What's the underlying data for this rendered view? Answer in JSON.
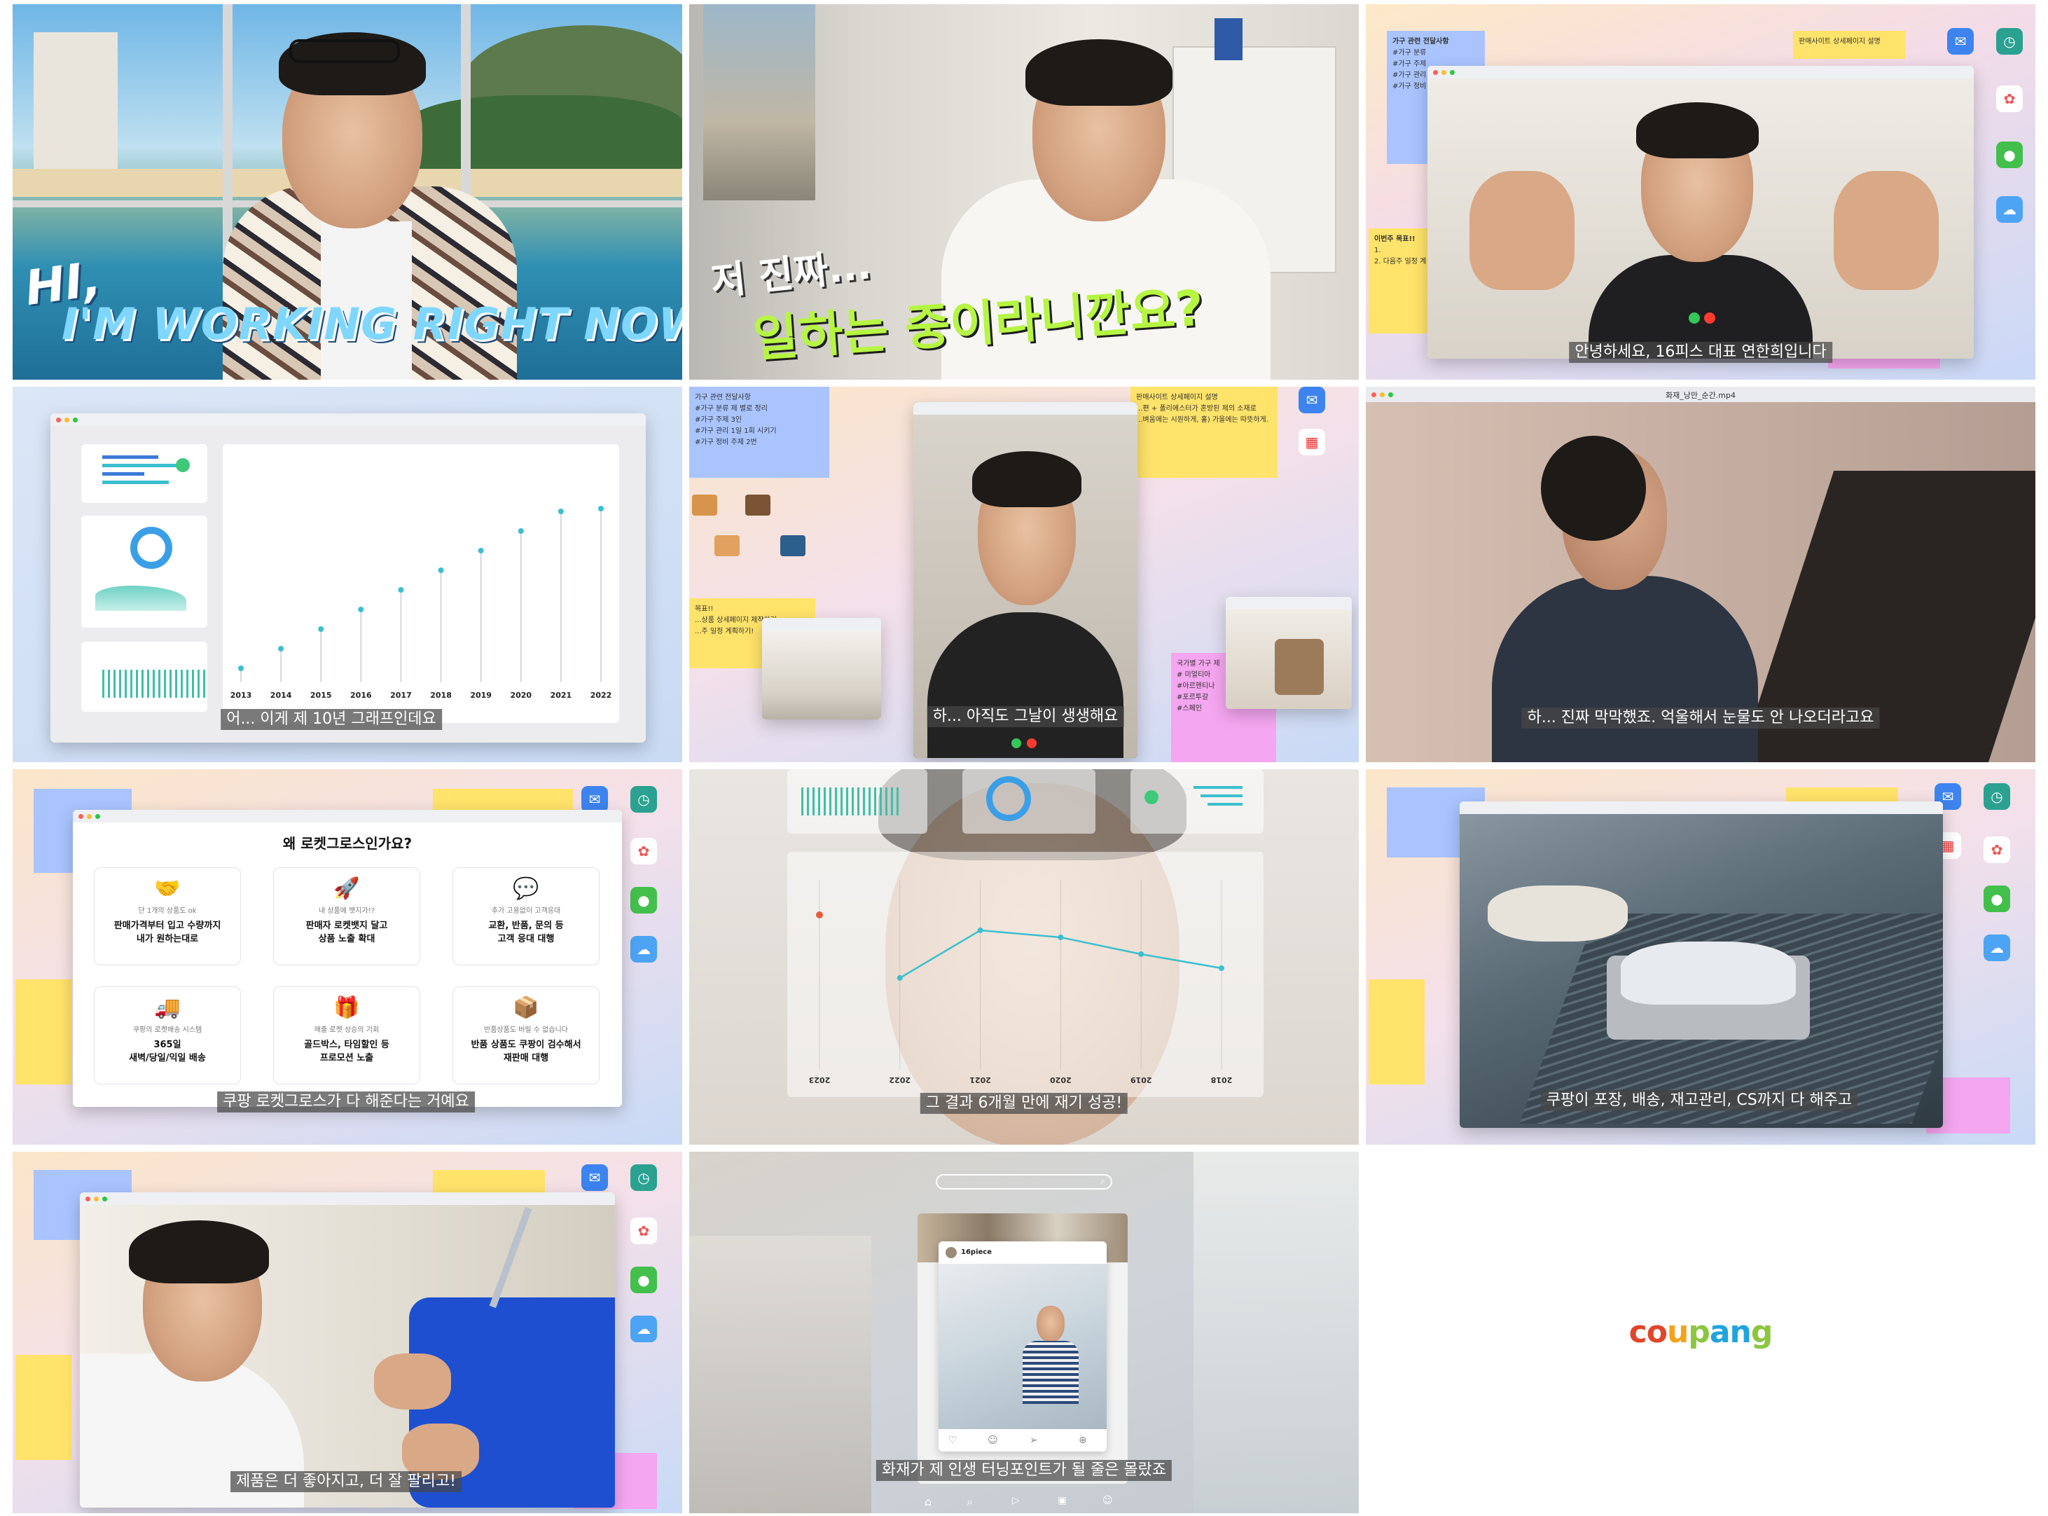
{
  "tiles": {
    "t1": {
      "title_line1": "HI,",
      "title_line2": "I'M WORKING RIGHT NOW"
    },
    "t2": {
      "line1": "저 진짜...",
      "line2": "일하는 중이라니깐요?"
    },
    "t3": {
      "caption": "안녕하세요, 16피스 대표 연한희입니다",
      "sticky_blue_title": "가구 관련 전달사항",
      "sticky_blue_items": [
        "#가구 분류 ",
        "#가구 주제 ",
        "#가구 관리 ",
        "#가구 정비 "
      ],
      "sticky_yellow_title": "판매사이트 상세페이지 설명",
      "sticky_left_title": "이번주 목표!!",
      "sticky_left_items": [
        "1.",
        "2. 다음주 일정 계"
      ]
    },
    "t4": {
      "caption": "어... 이게 제 10년 그래프인데요",
      "years": [
        "2013",
        "2014",
        "2015",
        "2016",
        "2017",
        "2018",
        "2019",
        "2020",
        "2021",
        "2022"
      ]
    },
    "t5": {
      "caption": "하... 아직도 그날이 생생해요",
      "sticky_blue_items": [
        "가구 관련 전달사항",
        "#가구 분류 제 별로 정리",
        "#가구 주제 3인",
        "#가구 관리 1일 1회 시키기",
        "#가구 정비 주제 2번"
      ],
      "sticky_yellow_items": [
        "판매사이트 상세페이지 설명",
        "...편 + 폴리에스터가 혼방된 제의 소재로",
        "...벼움에는 시원하게, 홀) 가을에는 따뜻하게."
      ],
      "sticky_yellow2_items": [
        "목표!!",
        "...상품 상세페이지 제작하기.",
        "...주 일정 계획하기!"
      ],
      "sticky_pink_items": [
        "국가별 가구 제",
        "# 미얼티아",
        "#아르헨티나",
        "#포르투갈",
        "#스페인"
      ]
    },
    "t6": {
      "caption": "하... 진짜 막막했죠. 억울해서 눈물도 안 나오더라고요",
      "filename": "화재_낭만_순간.mp4"
    },
    "t7": {
      "caption": "쿠팡 로켓그로스가 다 해준다는 거예요",
      "heading": "왜 로켓그로스인가요?",
      "features": [
        {
          "icon": "handshake-icon",
          "glyph": "🤝",
          "sub": "단 1개의 상품도 ok",
          "main": [
            "판매가격부터 입고 수량까지",
            "내가 원하는대로"
          ]
        },
        {
          "icon": "rocket-icon",
          "glyph": "🚀",
          "sub": "내 상품에 뱃지가!?",
          "main": [
            "판매자 로켓뱃지 달고",
            "상품 노출 확대"
          ]
        },
        {
          "icon": "chat-icon",
          "glyph": "💬",
          "sub": "추가 고용없이 고객응대",
          "main": [
            "교환, 반품, 문의 등",
            "고객 응대 대행"
          ]
        },
        {
          "icon": "truck-icon",
          "glyph": "🚚",
          "sub": "쿠팡의 로켓배송 시스템",
          "main": [
            "365일",
            "새벽/당일/익일 배송"
          ]
        },
        {
          "icon": "gift-icon",
          "glyph": "🎁",
          "sub": "매출 로켓 상승의 기회",
          "main": [
            "골드박스, 타임할인 등",
            "프로모션 노출"
          ]
        },
        {
          "icon": "box-check-icon",
          "glyph": "📦",
          "sub": "반품상품도 버릴 수 없습니다",
          "main": [
            "반품 상품도 쿠팡이 검수해서",
            "재판매 대행"
          ]
        }
      ]
    },
    "t8": {
      "caption": "그 결과 6개월 만에 재기 성공!",
      "years": [
        "2023",
        "2022",
        "2021",
        "2020",
        "2019",
        "2018"
      ]
    },
    "t9": {
      "caption": "쿠팡이 포장, 배송, 재고관리, CS까지 다 해주고"
    },
    "t10": {
      "caption": "제품은 더 좋아지고, 더 잘 팔리고!"
    },
    "t11": {
      "caption": "화재가 제 인생 터닝포인트가 될 줄은 몰랐죠",
      "profile_name": "16piece"
    },
    "t12": {
      "logo": "coupang"
    }
  },
  "colors": {
    "sticky_blue": "#a9c4ff",
    "sticky_yellow": "#ffe36a",
    "sticky_pink": "#f5a6f0",
    "accent_teal": "#3bbfcf",
    "accent_green": "#b6f542",
    "coupang_c": "#e0462b",
    "coupang_o": "#f4a31b",
    "coupang_u": "#8cc63f",
    "coupang_p": "#20a4dd"
  }
}
